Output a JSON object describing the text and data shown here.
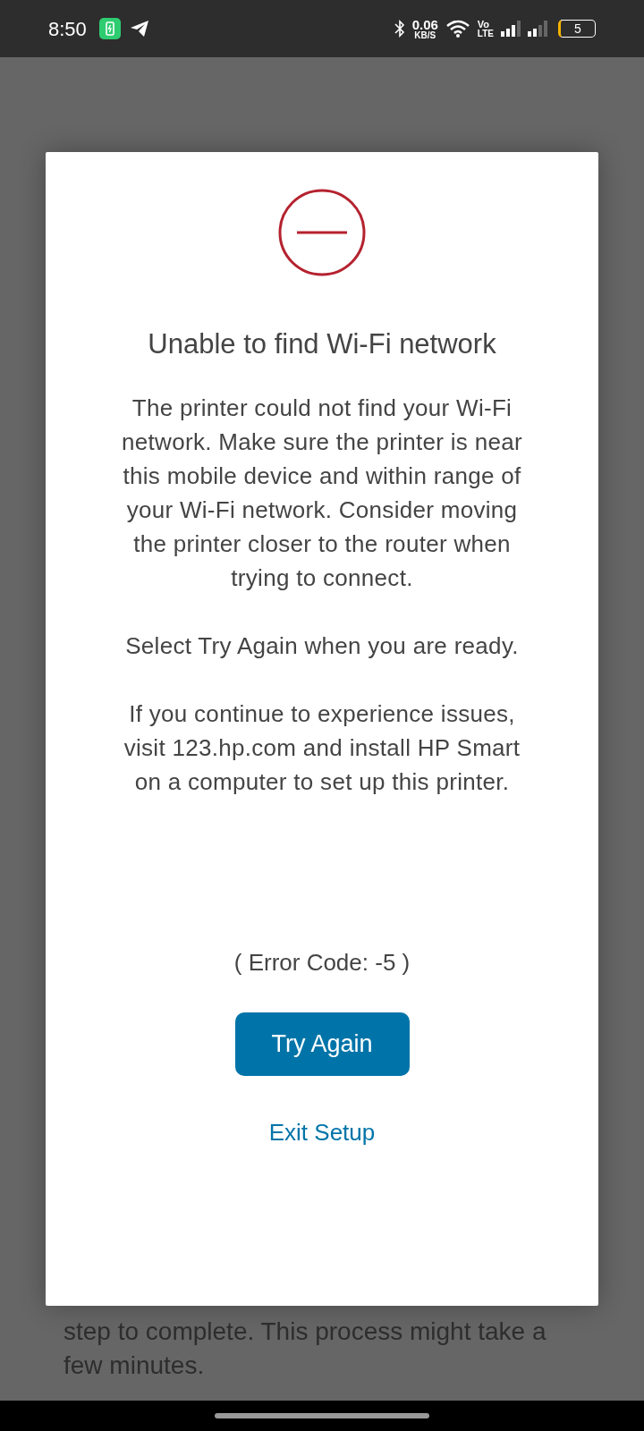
{
  "status_bar": {
    "time": "8:50",
    "net_speed": "0.06",
    "net_unit": "KB/S",
    "volte_top": "Vo",
    "volte_bottom": "LTE",
    "battery": "5"
  },
  "dialog": {
    "title": "Unable to find Wi-Fi network",
    "paragraphs": [
      "The printer could not find your Wi-Fi network. Make sure the printer is near this mobile device and within range of your Wi-Fi network. Consider moving the printer closer to the router when trying to connect.",
      "Select Try Again when you are ready.",
      "If you continue to experience issues, visit 123.hp.com and install HP Smart on a computer to set up this printer."
    ],
    "error_code": "( Error Code: -5 )",
    "primary_button": "Try Again",
    "secondary_link": "Exit Setup"
  },
  "background_text": "step to complete. This process might take a few minutes."
}
